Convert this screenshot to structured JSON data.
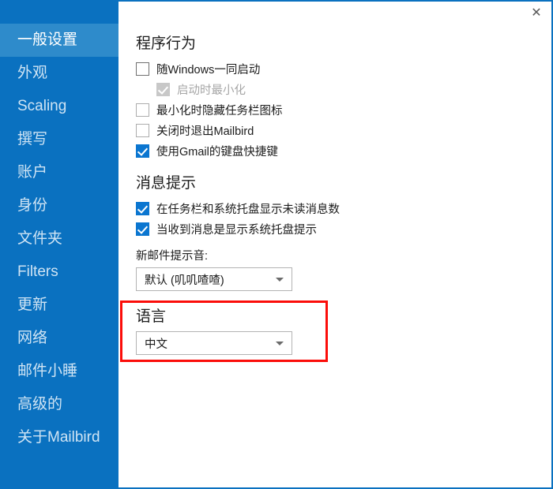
{
  "window": {
    "close_icon": "✕"
  },
  "sidebar": {
    "items": [
      {
        "label": "一般设置",
        "selected": true
      },
      {
        "label": "外观",
        "selected": false
      },
      {
        "label": "Scaling",
        "selected": false
      },
      {
        "label": "撰写",
        "selected": false
      },
      {
        "label": "账户",
        "selected": false
      },
      {
        "label": "身份",
        "selected": false
      },
      {
        "label": "文件夹",
        "selected": false
      },
      {
        "label": "Filters",
        "selected": false
      },
      {
        "label": "更新",
        "selected": false
      },
      {
        "label": "网络",
        "selected": false
      },
      {
        "label": "邮件小睡",
        "selected": false
      },
      {
        "label": "高级的",
        "selected": false
      },
      {
        "label": "关于Mailbird",
        "selected": false
      }
    ]
  },
  "program_behavior": {
    "title": "程序行为",
    "options": [
      {
        "label": "随Windows一同启动",
        "checked": false,
        "disabled": false,
        "indented": false
      },
      {
        "label": "启动时最小化",
        "checked": true,
        "disabled": true,
        "indented": true
      },
      {
        "label": "最小化时隐藏任务栏图标",
        "checked": false,
        "disabled": false,
        "indented": false
      },
      {
        "label": "关闭时退出Mailbird",
        "checked": false,
        "disabled": false,
        "indented": false
      },
      {
        "label": "使用Gmail的键盘快捷键",
        "checked": true,
        "disabled": false,
        "indented": false
      }
    ]
  },
  "notifications": {
    "title": "消息提示",
    "options": [
      {
        "label": "在任务栏和系统托盘显示未读消息数",
        "checked": true,
        "disabled": false,
        "indented": false
      },
      {
        "label": "当收到消息是显示系统托盘提示",
        "checked": true,
        "disabled": false,
        "indented": false
      }
    ],
    "sound_label": "新邮件提示音:",
    "sound_value": "默认 (叽叽喳喳)"
  },
  "language": {
    "title": "语言",
    "value": "中文",
    "highlight_color": "#fb0d09"
  },
  "theme": {
    "sidebar_bg": "#0a71c0",
    "sidebar_selected_bg": "#2e8bcb",
    "accent": "#0b76d0"
  }
}
